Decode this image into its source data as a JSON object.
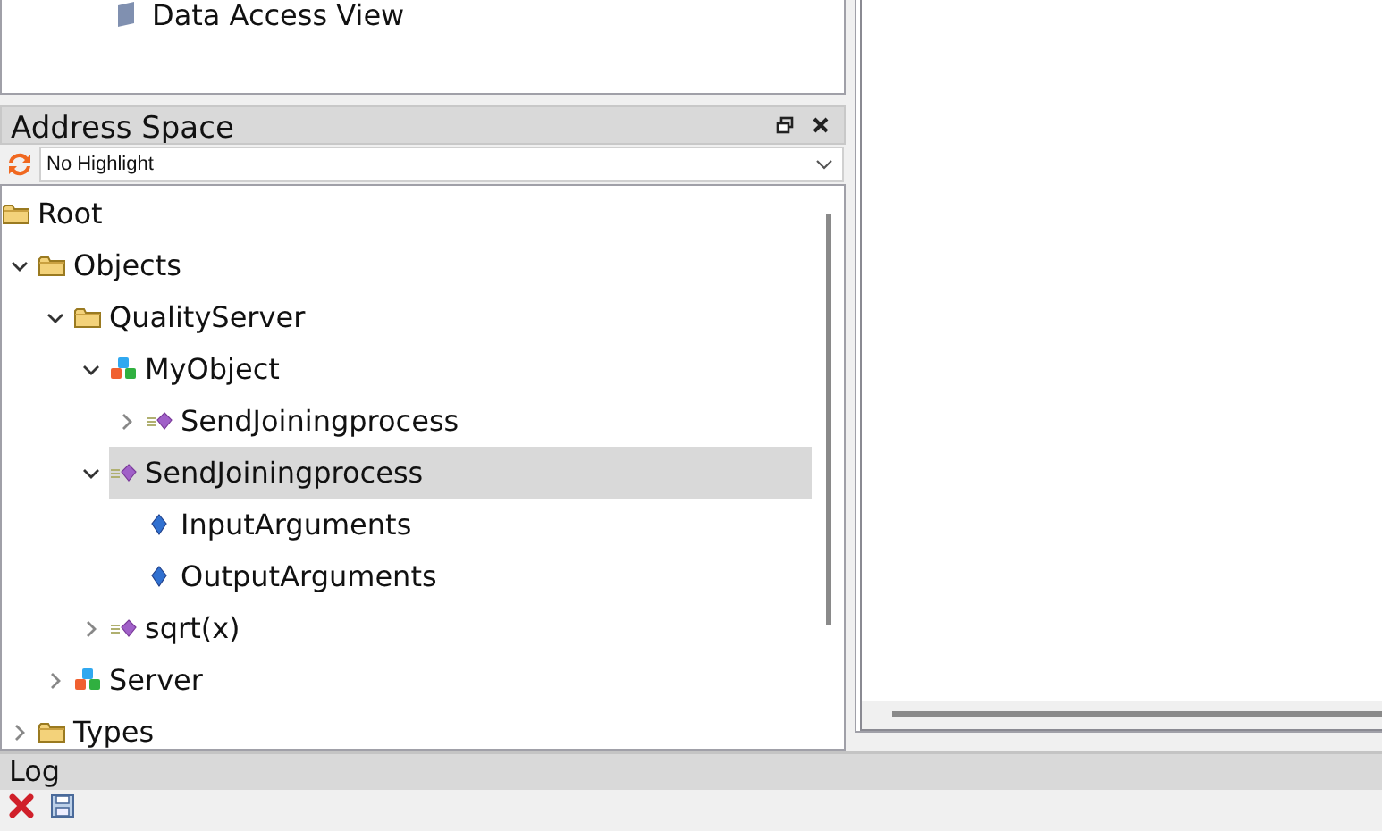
{
  "top_pane": {
    "items": [
      {
        "label": "Data Access View"
      }
    ]
  },
  "address_space": {
    "title": "Address Space",
    "highlight": {
      "value": "No Highlight"
    },
    "tree": [
      {
        "label": "Root",
        "kind": "folder",
        "children": [
          {
            "label": "Objects",
            "kind": "folder",
            "expanded": true,
            "selected": false,
            "children": [
              {
                "label": "QualityServer",
                "kind": "folder",
                "expanded": true,
                "selected": false,
                "children": [
                  {
                    "label": "MyObject",
                    "kind": "object",
                    "expanded": true,
                    "selected": false,
                    "children": [
                      {
                        "label": "SendJoiningprocess",
                        "kind": "method",
                        "expanded": false,
                        "selected": false
                      }
                    ]
                  },
                  {
                    "label": "SendJoiningprocess",
                    "kind": "method",
                    "expanded": true,
                    "selected": true,
                    "children": [
                      {
                        "label": "InputArguments",
                        "kind": "property",
                        "selected": false
                      },
                      {
                        "label": "OutputArguments",
                        "kind": "property",
                        "selected": false
                      }
                    ]
                  },
                  {
                    "label": "sqrt(x)",
                    "kind": "method",
                    "expanded": false,
                    "selected": false
                  }
                ]
              },
              {
                "label": "Server",
                "kind": "object",
                "expanded": false,
                "selected": false
              }
            ]
          },
          {
            "label": "Types",
            "kind": "folder",
            "expanded": false,
            "selected": false
          }
        ]
      }
    ]
  },
  "log": {
    "title": "Log"
  }
}
